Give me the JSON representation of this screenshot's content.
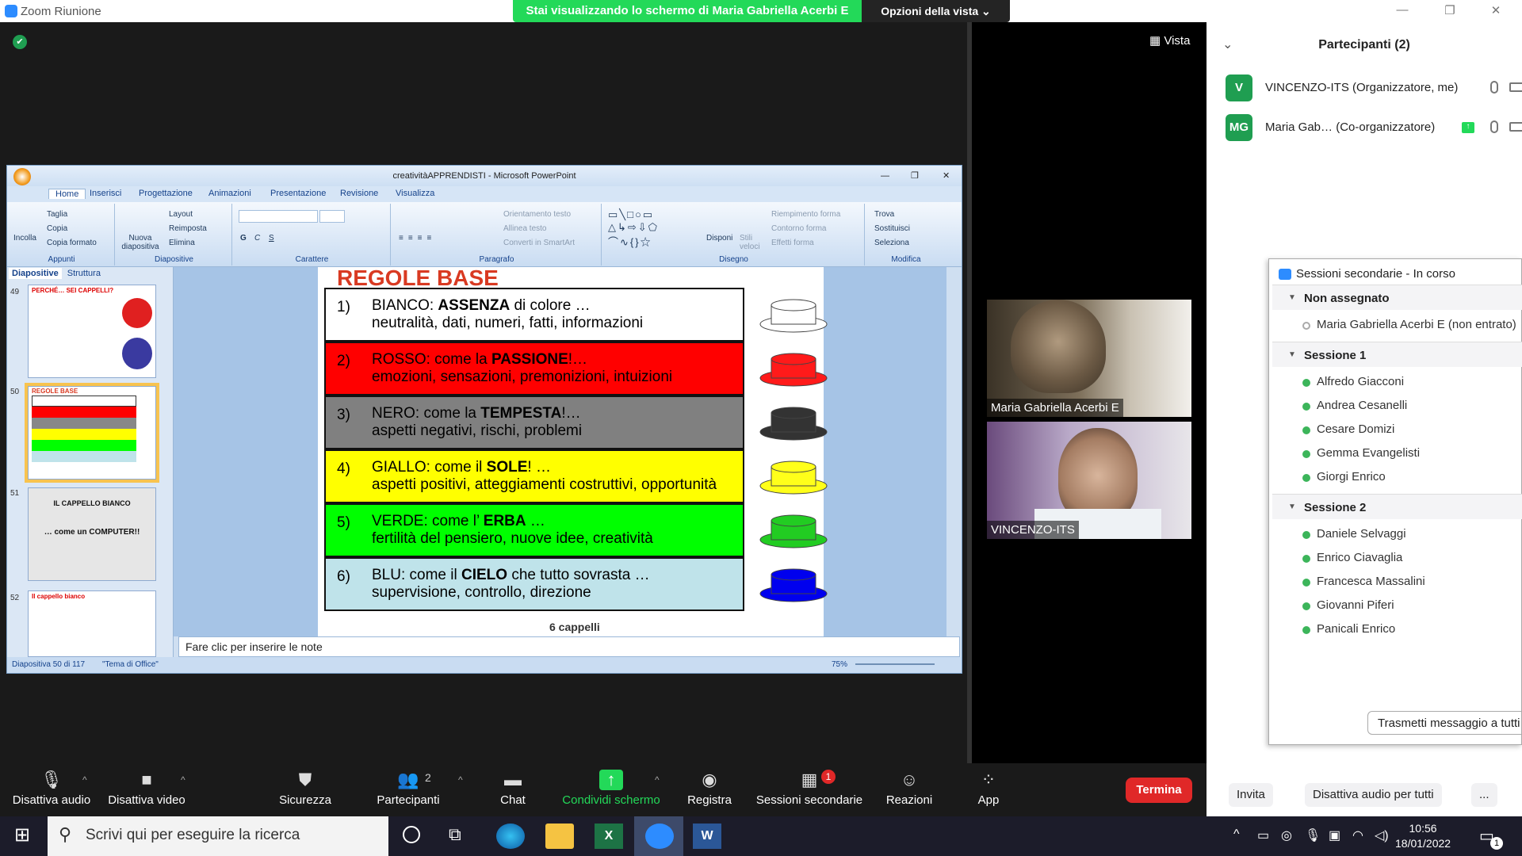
{
  "window": {
    "app_title": "Zoom Riunione",
    "share_banner": "Stai visualizzando lo schermo di Maria Gabriella Acerbi E",
    "view_options": "Opzioni della vista",
    "vista": "Vista",
    "minimize": "—",
    "restore": "❐",
    "close": "✕"
  },
  "ppt": {
    "title": "creativitàAPPRENDISTI - Microsoft PowerPoint",
    "tabs": [
      "Home",
      "Inserisci",
      "Progettazione",
      "Animazioni",
      "Presentazione",
      "Revisione",
      "Visualizza"
    ],
    "groups": {
      "appunti": "Appunti",
      "diapositive": "Diapositive",
      "carattere": "Carattere",
      "paragrafo": "Paragrafo",
      "disegno": "Disegno",
      "modifica": "Modifica"
    },
    "ribbon": {
      "incolla": "Incolla",
      "taglia": "Taglia",
      "copia": "Copia",
      "copia_formato": "Copia formato",
      "nuova_diapositiva": "Nuova diapositiva",
      "layout": "Layout",
      "reimposta": "Reimposta",
      "elimina": "Elimina",
      "orientamento_testo": "Orientamento testo",
      "allinea_testo": "Allinea testo",
      "converti_smartart": "Converti in SmartArt",
      "disponi": "Disponi",
      "stili_veloci": "Stili veloci",
      "riempimento_forma": "Riempimento forma",
      "contorno_forma": "Contorno forma",
      "effetti_forma": "Effetti forma",
      "trova": "Trova",
      "sostituisci": "Sostituisci",
      "seleziona": "Seleziona"
    },
    "pane_tabs": [
      "Diapositive",
      "Struttura"
    ],
    "thumbs": [
      {
        "num": "49",
        "title": "PERCHÉ… SEI CAPPELLI?"
      },
      {
        "num": "50",
        "title": "REGOLE BASE"
      },
      {
        "num": "51",
        "title": "IL CAPPELLO BIANCO",
        "sub": "… come un COMPUTER!!"
      },
      {
        "num": "52",
        "title": "Il cappello bianco"
      }
    ],
    "slide": {
      "title": "REGOLE BASE",
      "caption": "6 cappelli",
      "rows": [
        {
          "num": "1)",
          "l1_pre": "BIANCO: ",
          "l1_bold": "ASSENZA",
          "l1_post": " di colore …",
          "l2": "neutralità, dati, numeri, fatti, informazioni",
          "bg": "#ffffff",
          "hat": "#ffffff"
        },
        {
          "num": "2)",
          "l1_pre": "ROSSO: come la ",
          "l1_bold": "PASSIONE",
          "l1_post": "!…",
          "l2": "emozioni, sensazioni, premonizioni, intuizioni",
          "bg": "#ff0000",
          "hat": "#ff1a1a"
        },
        {
          "num": "3)",
          "l1_pre": "NERO: come la ",
          "l1_bold": "TEMPESTA",
          "l1_post": "!…",
          "l2": "aspetti negativi, rischi, problemi",
          "bg": "#808080",
          "hat": "#333333"
        },
        {
          "num": "4)",
          "l1_pre": "GIALLO: come il ",
          "l1_bold": "SOLE",
          "l1_post": "! …",
          "l2": "aspetti positivi, atteggiamenti costruttivi, opportunità",
          "bg": "#ffff00",
          "hat": "#ffff1a"
        },
        {
          "num": "5)",
          "l1_pre": "VERDE: come l’ ",
          "l1_bold": "ERBA",
          "l1_post": " …",
          "l2": "fertilità del pensiero, nuove idee, creatività",
          "bg": "#00ff00",
          "hat": "#22cc22"
        },
        {
          "num": "6)",
          "l1_pre": "BLU: come il ",
          "l1_bold": "CIELO",
          "l1_post": " che tutto sovrasta …",
          "l2": "supervisione, controllo, direzione",
          "bg": "#bfe3ea",
          "hat": "#0000ee"
        }
      ]
    },
    "notes_placeholder": "Fare clic per inserire le note",
    "status": {
      "slide": "Diapositiva 50 di 117",
      "theme": "\"Tema di Office\"",
      "zoom": "75%"
    }
  },
  "videos": [
    {
      "name": "Maria Gabriella Acerbi E"
    },
    {
      "name": "VINCENZO-ITS"
    }
  ],
  "participants": {
    "title": "Partecipanti (2)",
    "list": [
      {
        "initials": "V",
        "name": "VINCENZO-ITS (Organizzatore, me)",
        "color": "#1f9e51"
      },
      {
        "initials": "MG",
        "name": "Maria Gab…  (Co-organizzatore)",
        "color": "#1f9e51"
      }
    ],
    "invite": "Invita",
    "mute_all": "Disattiva audio per tutti",
    "more": "..."
  },
  "breakout": {
    "title": "Sessioni secondarie - In corso",
    "sections": [
      {
        "name": "Non assegnato",
        "members": [
          "Maria Gabriella Acerbi E (non entrato)"
        ]
      },
      {
        "name": "Sessione 1",
        "members": [
          "Alfredo Giacconi",
          "Andrea Cesanelli",
          "Cesare Domizi",
          "Gemma Evangelisti",
          "Giorgi Enrico"
        ]
      },
      {
        "name": "Sessione 2",
        "members": [
          "Daniele Selvaggi",
          "Enrico Ciavaglia",
          "Francesca Massalini",
          "Giovanni Piferi",
          "Panicali Enrico"
        ]
      }
    ],
    "send_message": "Trasmetti messaggio a tutti"
  },
  "toolbar": {
    "audio": "Disattiva audio",
    "video": "Disattiva video",
    "security": "Sicurezza",
    "participants": "Partecipanti",
    "participants_count": "2",
    "chat": "Chat",
    "share": "Condividi schermo",
    "record": "Registra",
    "breakout": "Sessioni secondarie",
    "breakout_badge": "1",
    "reactions": "Reazioni",
    "apps": "App",
    "end": "Termina"
  },
  "taskbar": {
    "search_placeholder": "Scrivi qui per eseguire la ricerca",
    "time": "10:56",
    "date": "18/01/2022",
    "notif_count": "1"
  },
  "colors": {
    "zoom_green": "#23d959",
    "zoom_blue": "#2d8cff",
    "end_red": "#e02828"
  }
}
